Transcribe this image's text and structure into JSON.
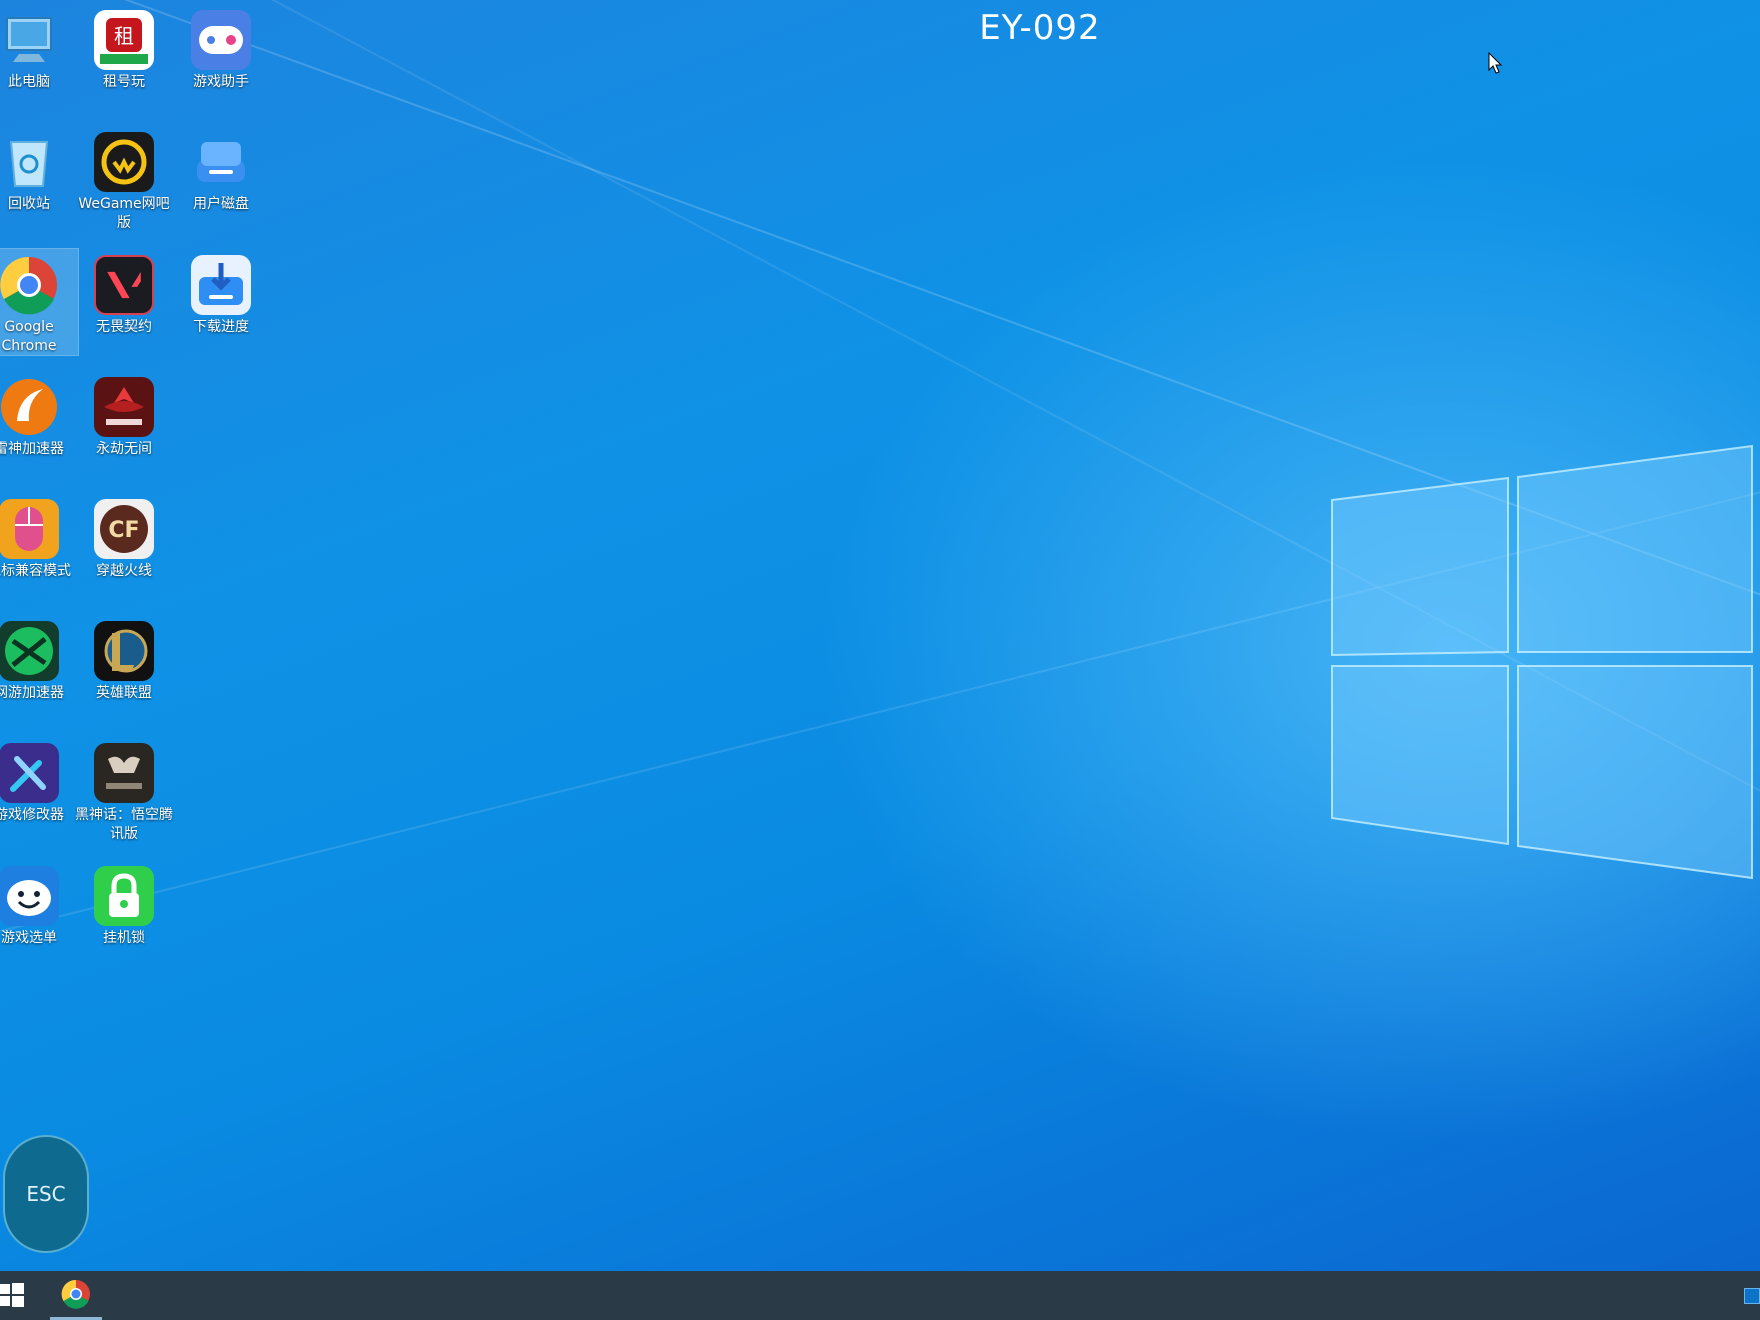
{
  "machine_id": "EY-092",
  "esc_label": "ESC",
  "desktop_icons": [
    {
      "label": "此电脑",
      "icon": "computer-icon"
    },
    {
      "label": "租号玩",
      "icon": "zuhaowan-icon"
    },
    {
      "label": "游戏助手",
      "icon": "game-assistant-icon"
    },
    {
      "label": "回收站",
      "icon": "recycle-bin-icon"
    },
    {
      "label": "WeGame网吧版",
      "icon": "wegame-icon"
    },
    {
      "label": "用户磁盘",
      "icon": "user-disk-icon"
    },
    {
      "label": "Google Chrome",
      "icon": "chrome-icon"
    },
    {
      "label": "无畏契约",
      "icon": "valorant-icon"
    },
    {
      "label": "下载进度",
      "icon": "download-progress-icon"
    },
    {
      "label": "雷神加速器",
      "icon": "leishen-accelerator-icon"
    },
    {
      "label": "永劫无间",
      "icon": "naraka-icon"
    },
    {
      "label": "鼠标兼容模式",
      "icon": "mouse-compat-icon"
    },
    {
      "label": "穿越火线",
      "icon": "crossfire-icon"
    },
    {
      "label": "网游加速器",
      "icon": "net-accelerator-icon"
    },
    {
      "label": "英雄联盟",
      "icon": "league-of-legends-icon"
    },
    {
      "label": "游戏修改器",
      "icon": "game-modifier-icon"
    },
    {
      "label": "黑神话：悟空腾讯版",
      "icon": "black-myth-wukong-icon"
    },
    {
      "label": "游戏选单",
      "icon": "game-menu-icon"
    },
    {
      "label": "挂机锁",
      "icon": "lock-icon"
    }
  ],
  "colors": {
    "taskbar": "#2b3a47",
    "esc_bg": "#0e6b8f",
    "desktop_blue": "#0a8be2"
  }
}
